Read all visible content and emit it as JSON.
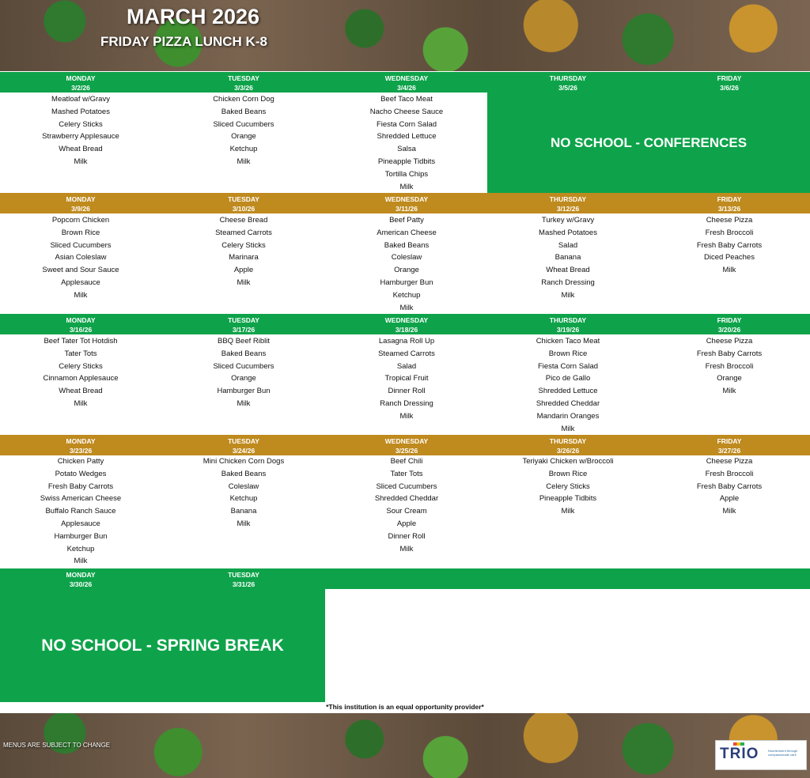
{
  "header": {
    "title": "MARCH 2026",
    "subtitle": "FRIDAY PIZZA LUNCH K-8"
  },
  "weeks": [
    {
      "days": [
        "MONDAY",
        "TUESDAY",
        "WEDNESDAY",
        "THURSDAY",
        "FRIDAY"
      ],
      "dates": [
        "3/2/26",
        "3/3/26",
        "3/4/26",
        "3/5/26",
        "3/6/26"
      ],
      "menus": [
        [
          "Meatloaf w/Gravy",
          "Mashed Potatoes",
          "Celery Sticks",
          "Strawberry Applesauce",
          "Wheat Bread",
          "Milk"
        ],
        [
          "Chicken Corn Dog",
          "Baked Beans",
          "Sliced Cucumbers",
          "Orange",
          "Ketchup",
          "Milk"
        ],
        [
          "Beef Taco Meat",
          "Nacho Cheese Sauce",
          "Fiesta Corn Salad",
          "Shredded Lettuce",
          "Salsa",
          "Pineapple Tidbits",
          "Tortilla Chips",
          "Milk"
        ]
      ],
      "notice": "NO SCHOOL - CONFERENCES"
    },
    {
      "days": [
        "MONDAY",
        "TUESDAY",
        "WEDNESDAY",
        "THURSDAY",
        "FRIDAY"
      ],
      "dates": [
        "3/9/26",
        "3/10/26",
        "3/11/26",
        "3/12/26",
        "3/13/26"
      ],
      "menus": [
        [
          "Popcorn Chicken",
          "Brown Rice",
          "Sliced Cucumbers",
          "Asian Coleslaw",
          "Sweet and Sour Sauce",
          "Applesauce",
          "Milk"
        ],
        [
          "Cheese Bread",
          "Steamed Carrots",
          "Celery Sticks",
          "Marinara",
          "Apple",
          "Milk"
        ],
        [
          "Beef Patty",
          "American Cheese",
          "Baked Beans",
          "Coleslaw",
          "Orange",
          "Hamburger Bun",
          "Ketchup",
          "Milk"
        ],
        [
          "Turkey w/Gravy",
          "Mashed Potatoes",
          "Salad",
          "Banana",
          "Wheat Bread",
          "Ranch Dressing",
          "Milk"
        ],
        [
          "Cheese Pizza",
          "Fresh Broccoli",
          "Fresh Baby Carrots",
          "Diced Peaches",
          "Milk"
        ]
      ]
    },
    {
      "days": [
        "MONDAY",
        "TUESDAY",
        "WEDNESDAY",
        "THURSDAY",
        "FRIDAY"
      ],
      "dates": [
        "3/16/26",
        "3/17/26",
        "3/18/26",
        "3/19/26",
        "3/20/26"
      ],
      "menus": [
        [
          "Beef Tater Tot Hotdish",
          "Tater Tots",
          "Celery Sticks",
          "Cinnamon Applesauce",
          "Wheat Bread",
          "Milk"
        ],
        [
          "BBQ Beef Riblit",
          "Baked Beans",
          "Sliced Cucumbers",
          "Orange",
          "Hamburger Bun",
          "Milk"
        ],
        [
          "Lasagna Roll Up",
          "Steamed Carrots",
          "Salad",
          "Tropical Fruit",
          "Dinner Roll",
          "Ranch Dressing",
          "Milk"
        ],
        [
          "Chicken Taco Meat",
          "Brown Rice",
          "Fiesta Corn Salad",
          "Pico de Gallo",
          "Shredded Lettuce",
          "Shredded Cheddar",
          "Mandarin Oranges",
          "Milk"
        ],
        [
          "Cheese Pizza",
          "Fresh Baby Carrots",
          "Fresh Broccoli",
          "Orange",
          "Milk"
        ]
      ]
    },
    {
      "days": [
        "MONDAY",
        "TUESDAY",
        "WEDNESDAY",
        "THURSDAY",
        "FRIDAY"
      ],
      "dates": [
        "3/23/26",
        "3/24/26",
        "3/25/26",
        "3/26/26",
        "3/27/26"
      ],
      "menus": [
        [
          "Chicken Patty",
          "Potato Wedges",
          "Fresh Baby Carrots",
          "Swiss American Cheese",
          "Buffalo Ranch Sauce",
          "Applesauce",
          "Hamburger Bun",
          "Ketchup",
          "Milk"
        ],
        [
          "Mini Chicken Corn Dogs",
          "Baked Beans",
          "Coleslaw",
          "Ketchup",
          "Banana",
          "Milk"
        ],
        [
          "Beef Chili",
          "Tater Tots",
          "Sliced Cucumbers",
          "Shredded Cheddar",
          "Sour Cream",
          "Apple",
          "Dinner Roll",
          "Milk"
        ],
        [
          "Teriyaki Chicken w/Broccoli",
          "Brown Rice",
          "Celery Sticks",
          "Pineapple Tidbits",
          "Milk"
        ],
        [
          "Cheese Pizza",
          "Fresh Broccoli",
          "Fresh Baby Carrots",
          "Apple",
          "Milk"
        ]
      ]
    },
    {
      "days": [
        "MONDAY",
        "TUESDAY"
      ],
      "dates": [
        "3/30/26",
        "3/31/26"
      ],
      "notice": "NO SCHOOL - SPRING BREAK"
    }
  ],
  "footer": {
    "equal_opportunity": "*This institution is an equal opportunity provider*",
    "change_note": "MENUS ARE SUBJECT TO CHANGE",
    "logo": "TRIO",
    "logo_tagline": "Nourishment through compassionate care"
  }
}
